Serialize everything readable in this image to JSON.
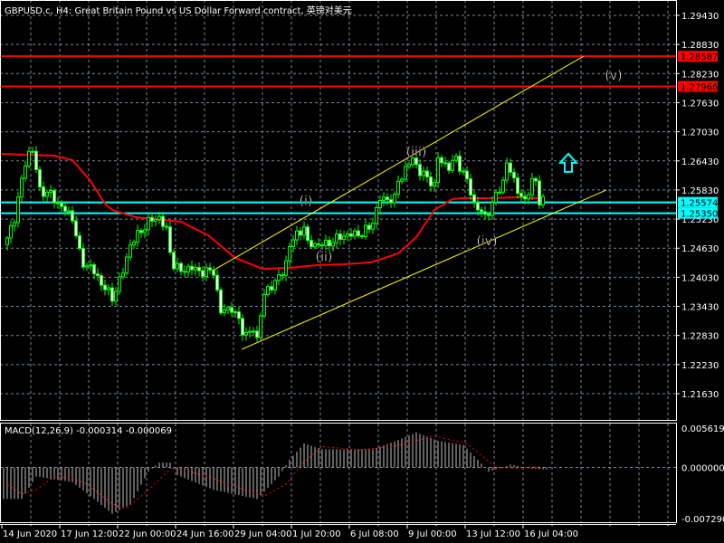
{
  "title": "GBPUSD.c, H4:  Great Britain Pound vs US Dollar Forward contract, 英镑对美元",
  "colors": {
    "background": "#000000",
    "grid": "#7a8a9a",
    "candle_wick": "#00ff00",
    "bear_body": "#ffffff",
    "bull_body": "#000000",
    "ma": "#ff0000",
    "channel": "#ffff00",
    "resistance": "#ff0000",
    "support": "#00ffff",
    "macd_hist": "#c0c0c0",
    "macd_signal": "#ff0000",
    "axis": "#ffffff"
  },
  "chart_data": [
    {
      "type": "candlestick",
      "symbol": "GBPUSD.c",
      "timeframe": "H4",
      "y_ticks": [
        "1.29430",
        "1.28830",
        "1.28230",
        "1.27630",
        "1.27030",
        "1.26430",
        "1.25830",
        "1.25230",
        "1.24630",
        "1.24030",
        "1.23430",
        "1.22830",
        "1.22230",
        "1.21630"
      ],
      "ylim": [
        1.2134,
        1.2975
      ],
      "x_tick_labels": [
        "14 Jun 2020",
        "17 Jun 12:00",
        "22 Jun 00:00",
        "24 Jun 16:00",
        "29 Jun 04:00",
        "1 Jul 20:00",
        "6 Jul 08:00",
        "9 Jul 00:00",
        "13 Jul 12:00",
        "16 Jul 04:00"
      ],
      "bars_per_x_label": 16,
      "bar_count": 149,
      "close_keypoints": [
        [
          0,
          1.24802
        ],
        [
          2,
          1.25269
        ],
        [
          5.5,
          1.26575
        ],
        [
          7,
          1.2665
        ],
        [
          9,
          1.25829
        ],
        [
          12,
          1.25735
        ],
        [
          14,
          1.25549
        ],
        [
          18,
          1.25269
        ],
        [
          20.5,
          1.24336
        ],
        [
          23,
          1.24242
        ],
        [
          25.5,
          1.23963
        ],
        [
          29,
          1.236
        ],
        [
          32,
          1.24149
        ],
        [
          34,
          1.24709
        ],
        [
          37,
          1.24989
        ],
        [
          39,
          1.25175
        ],
        [
          42,
          1.25269
        ],
        [
          44,
          1.24989
        ],
        [
          45.5,
          1.24336
        ],
        [
          48,
          1.24149
        ],
        [
          50.5,
          1.24242
        ],
        [
          53,
          1.24149
        ],
        [
          57,
          1.24149
        ],
        [
          59,
          1.2331
        ],
        [
          62,
          1.23403
        ],
        [
          64,
          1.23123
        ],
        [
          65.5,
          1.22843
        ],
        [
          68,
          1.22937
        ],
        [
          69,
          1.2275
        ],
        [
          70.5,
          1.2359
        ],
        [
          73,
          1.23869
        ],
        [
          76.5,
          1.24149
        ],
        [
          78,
          1.24709
        ],
        [
          82,
          1.25082
        ],
        [
          83,
          1.24709
        ],
        [
          88,
          1.24709
        ],
        [
          93,
          1.24896
        ],
        [
          98,
          1.24933
        ],
        [
          100.5,
          1.25082
        ],
        [
          103,
          1.25642
        ],
        [
          107,
          1.25642
        ],
        [
          108,
          1.26015
        ],
        [
          112,
          1.26482
        ],
        [
          114,
          1.26202
        ],
        [
          117,
          1.26015
        ],
        [
          118,
          1.25922
        ],
        [
          119,
          1.26482
        ],
        [
          122,
          1.26295
        ],
        [
          124,
          1.26482
        ],
        [
          127,
          1.26015
        ],
        [
          129,
          1.25549
        ],
        [
          132,
          1.25269
        ],
        [
          134,
          1.25549
        ],
        [
          137,
          1.26015
        ],
        [
          138,
          1.26388
        ],
        [
          140.5,
          1.25922
        ],
        [
          143,
          1.25549
        ],
        [
          145.5,
          1.26202
        ],
        [
          147,
          1.25549
        ],
        [
          148,
          1.25642
        ]
      ],
      "moving_average": [
        [
          -2,
          1.26575
        ],
        [
          13,
          1.26538
        ],
        [
          18,
          1.26444
        ],
        [
          23,
          1.26015
        ],
        [
          27,
          1.25549
        ],
        [
          29,
          1.25418
        ],
        [
          35.5,
          1.25269
        ],
        [
          48,
          1.25175
        ],
        [
          55.5,
          1.24896
        ],
        [
          63,
          1.24429
        ],
        [
          70.5,
          1.24205
        ],
        [
          78,
          1.24224
        ],
        [
          85.5,
          1.2428
        ],
        [
          93,
          1.24298
        ],
        [
          100.5,
          1.24336
        ],
        [
          108,
          1.24522
        ],
        [
          113,
          1.24858
        ],
        [
          118,
          1.25418
        ],
        [
          123,
          1.25642
        ],
        [
          125.5,
          1.2566
        ],
        [
          133,
          1.2566
        ],
        [
          140.5,
          1.2568
        ],
        [
          145.5,
          1.2566
        ],
        [
          148,
          1.25661
        ]
      ],
      "channel_upper": [
        [
          57.25,
          1.24187
        ],
        [
          159.25,
          1.2859
        ]
      ],
      "channel_lower": [
        [
          64.75,
          1.22544
        ],
        [
          165.5,
          1.25829
        ]
      ],
      "horizontal_lines": [
        {
          "price": 1.28587,
          "label": "1.28587",
          "kind": "resistance"
        },
        {
          "price": 1.27966,
          "label": "1.27966",
          "kind": "resistance"
        },
        {
          "price": 1.25574,
          "label": "1.25574",
          "kind": "support"
        },
        {
          "price": 1.2535,
          "label": "1.25350",
          "kind": "support"
        }
      ],
      "wave_labels": [
        {
          "text": "(i)",
          "bar": 82.5,
          "price": 1.2561
        },
        {
          "text": "(ii)",
          "bar": 87.5,
          "price": 1.2446
        },
        {
          "text": "(iii)",
          "bar": 113,
          "price": 1.2662
        },
        {
          "text": "(iv)",
          "bar": 132.5,
          "price": 1.2478
        },
        {
          "text": "(v)",
          "bar": 167.5,
          "price": 1.282
        }
      ],
      "up_arrow": {
        "bar": 155,
        "price": 1.2639
      }
    },
    {
      "type": "bar",
      "name": "MACD",
      "label": "MACD(12,26,9) -0.000314 -0.000069",
      "y_ticks": [
        "0.005619",
        "0.000000",
        "-0.007290"
      ],
      "ylim": [
        -0.00729,
        0.005619
      ],
      "histogram_keypoints": [
        [
          -1,
          -0.0045
        ],
        [
          4,
          -0.0045
        ],
        [
          8,
          -0.0013
        ],
        [
          18,
          -0.0021
        ],
        [
          22,
          -0.0037
        ],
        [
          29,
          -0.0066
        ],
        [
          34,
          -0.0053
        ],
        [
          39,
          -0.0006
        ],
        [
          42,
          0.0007
        ],
        [
          45,
          0.0007
        ],
        [
          47,
          -0.0011
        ],
        [
          57,
          -0.0032
        ],
        [
          69,
          -0.0045
        ],
        [
          75,
          -0.0013
        ],
        [
          78,
          0.0011
        ],
        [
          82,
          0.0034
        ],
        [
          87,
          0.0026
        ],
        [
          101,
          0.0026
        ],
        [
          107,
          0.0037
        ],
        [
          113,
          0.005
        ],
        [
          119,
          0.0038
        ],
        [
          126,
          0.0032
        ],
        [
          130,
          0.0011
        ],
        [
          133,
          -0.0006
        ],
        [
          139,
          0.0004
        ],
        [
          145,
          -0.0002
        ],
        [
          149,
          -0.0003
        ]
      ],
      "signal_keypoints": [
        [
          -1,
          -0.0021
        ],
        [
          4,
          -0.0038
        ],
        [
          8,
          -0.0032
        ],
        [
          13,
          -0.0013
        ],
        [
          18,
          -0.0015
        ],
        [
          22,
          -0.0024
        ],
        [
          29,
          -0.0052
        ],
        [
          33,
          -0.0058
        ],
        [
          39,
          -0.0032
        ],
        [
          45.5,
          0
        ],
        [
          55.5,
          -0.0013
        ],
        [
          65.5,
          -0.0032
        ],
        [
          71,
          -0.0041
        ],
        [
          77,
          -0.0024
        ],
        [
          81,
          0.0003
        ],
        [
          87,
          0.003
        ],
        [
          97,
          0.0025
        ],
        [
          107,
          0.003
        ],
        [
          118,
          0.0045
        ],
        [
          127,
          0.0034
        ],
        [
          135,
          0
        ],
        [
          140.5,
          -0.0001
        ],
        [
          147,
          0.0001
        ]
      ]
    }
  ]
}
